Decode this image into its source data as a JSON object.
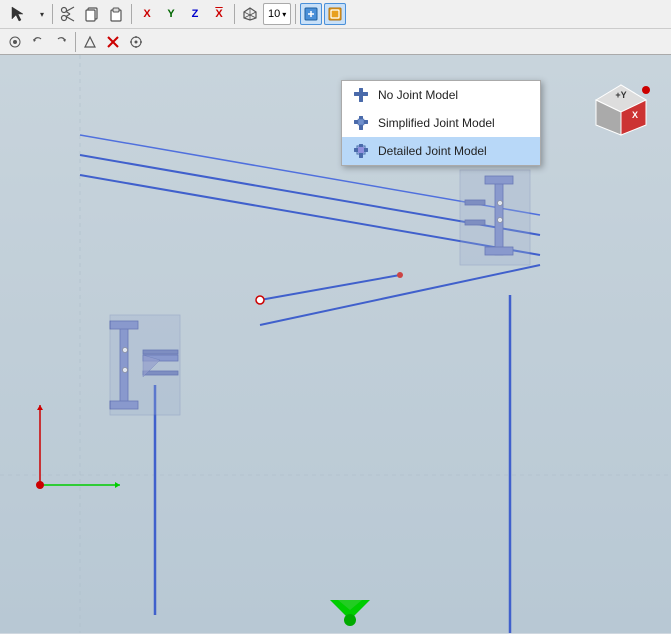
{
  "toolbar": {
    "row1": {
      "buttons": [
        {
          "name": "select-tool",
          "icon": "↖",
          "label": "Select"
        },
        {
          "name": "dropdown-arrow",
          "icon": "▾",
          "label": ""
        },
        {
          "name": "cut",
          "icon": "✂",
          "label": "Cut"
        },
        {
          "name": "copy",
          "icon": "⧉",
          "label": "Copy"
        },
        {
          "name": "paste",
          "icon": "📋",
          "label": "Paste"
        },
        {
          "name": "x-axis",
          "icon": "X",
          "label": "X"
        },
        {
          "name": "y-axis",
          "icon": "Y",
          "label": "Y"
        },
        {
          "name": "z-axis",
          "icon": "Z",
          "label": "Z"
        },
        {
          "name": "x-neg",
          "icon": "X",
          "label": "X neg"
        },
        {
          "name": "tool9",
          "icon": "⊕",
          "label": ""
        },
        {
          "name": "number-10",
          "label": "10"
        },
        {
          "name": "active-tool",
          "icon": "■",
          "label": "active",
          "active": true
        },
        {
          "name": "joint-icon",
          "icon": "⊞",
          "label": "Joint Model"
        }
      ]
    },
    "row2": {
      "buttons": [
        {
          "name": "r2b1",
          "icon": "⊙"
        },
        {
          "name": "r2b2",
          "icon": "↩"
        },
        {
          "name": "r2b3",
          "icon": "↪"
        },
        {
          "name": "r2b4",
          "icon": "⊲"
        },
        {
          "name": "r2b5",
          "icon": "✕"
        },
        {
          "name": "r2b6",
          "icon": "⚙"
        }
      ]
    }
  },
  "dropdown_menu": {
    "items": [
      {
        "id": "no-joint",
        "label": "No Joint Model",
        "selected": false
      },
      {
        "id": "simplified-joint",
        "label": "Simplified Joint Model",
        "selected": false
      },
      {
        "id": "detailed-joint",
        "label": "Detailed Joint Model",
        "selected": true
      }
    ]
  },
  "navcube": {
    "label": "NavCube",
    "plus_y": "+Y",
    "x_label": "X"
  },
  "scene": {
    "description": "3D structural frame view with beam-column connections"
  }
}
